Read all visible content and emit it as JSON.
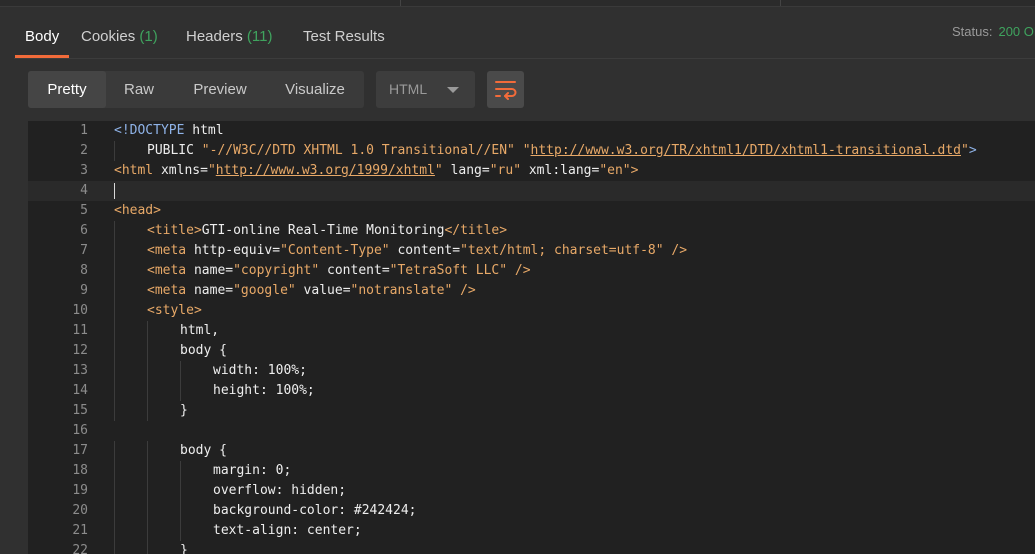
{
  "tabs": [
    {
      "label": "Body",
      "count": null,
      "active": true
    },
    {
      "label": "Cookies",
      "count": "(1)",
      "active": false
    },
    {
      "label": "Headers",
      "count": "(11)",
      "active": false
    },
    {
      "label": "Test Results",
      "count": null,
      "active": false
    }
  ],
  "status": {
    "label": "Status:",
    "value": "200 OK"
  },
  "view_modes": [
    "Pretty",
    "Raw",
    "Preview",
    "Visualize"
  ],
  "active_view": "Pretty",
  "language": {
    "selected": "HTML"
  },
  "wrap_icon": "wrap-lines-icon",
  "colors": {
    "accent": "#f26b3a",
    "count_green": "#3fa35e",
    "tag": "#e8a968",
    "doctype": "#8fb3e8"
  },
  "editor": {
    "current_line": 4,
    "lines": [
      {
        "n": "1",
        "indent": 0,
        "tokens": [
          [
            "decl",
            "<!DOCTYPE"
          ],
          [
            "plain",
            " html"
          ]
        ]
      },
      {
        "n": "2",
        "indent": 1,
        "tokens": [
          [
            "plain",
            "PUBLIC "
          ],
          [
            "str",
            "\"-//W3C//DTD XHTML 1.0 Transitional//EN\""
          ],
          [
            "plain",
            " "
          ],
          [
            "str",
            "\""
          ],
          [
            "url",
            "http://www.w3.org/TR/xhtml1/DTD/xhtml1-transitional.dtd"
          ],
          [
            "str",
            "\""
          ],
          [
            "decl",
            ">"
          ]
        ]
      },
      {
        "n": "3",
        "indent": 0,
        "tokens": [
          [
            "tag",
            "<html"
          ],
          [
            "attr",
            " xmlns="
          ],
          [
            "str",
            "\""
          ],
          [
            "url",
            "http://www.w3.org/1999/xhtml"
          ],
          [
            "str",
            "\""
          ],
          [
            "attr",
            " lang="
          ],
          [
            "str",
            "\"ru\""
          ],
          [
            "attr",
            " xml:lang="
          ],
          [
            "str",
            "\"en\""
          ],
          [
            "tag",
            ">"
          ]
        ]
      },
      {
        "n": "4",
        "indent": 0,
        "tokens": []
      },
      {
        "n": "5",
        "indent": 0,
        "tokens": [
          [
            "tag",
            "<head>"
          ]
        ]
      },
      {
        "n": "6",
        "indent": 1,
        "tokens": [
          [
            "tag",
            "<title>"
          ],
          [
            "plain",
            "GTI-online Real-Time Monitoring"
          ],
          [
            "tag",
            "</title>"
          ]
        ]
      },
      {
        "n": "7",
        "indent": 1,
        "tokens": [
          [
            "tag",
            "<meta"
          ],
          [
            "attr",
            " http-equiv="
          ],
          [
            "str",
            "\"Content-Type\""
          ],
          [
            "attr",
            " content="
          ],
          [
            "str",
            "\"text/html; charset=utf-8\""
          ],
          [
            "tag",
            " />"
          ]
        ]
      },
      {
        "n": "8",
        "indent": 1,
        "tokens": [
          [
            "tag",
            "<meta"
          ],
          [
            "attr",
            " name="
          ],
          [
            "str",
            "\"copyright\""
          ],
          [
            "attr",
            " content="
          ],
          [
            "str",
            "\"TetraSoft LLC\""
          ],
          [
            "tag",
            " />"
          ]
        ]
      },
      {
        "n": "9",
        "indent": 1,
        "tokens": [
          [
            "tag",
            "<meta"
          ],
          [
            "attr",
            " name="
          ],
          [
            "str",
            "\"google\""
          ],
          [
            "attr",
            " value="
          ],
          [
            "str",
            "\"notranslate\""
          ],
          [
            "tag",
            " />"
          ]
        ]
      },
      {
        "n": "10",
        "indent": 1,
        "tokens": [
          [
            "tag",
            "<style>"
          ]
        ]
      },
      {
        "n": "11",
        "indent": 2,
        "tokens": [
          [
            "plain",
            "html,"
          ]
        ]
      },
      {
        "n": "12",
        "indent": 2,
        "tokens": [
          [
            "plain",
            "body {"
          ]
        ]
      },
      {
        "n": "13",
        "indent": 3,
        "tokens": [
          [
            "plain",
            "width: 100%;"
          ]
        ]
      },
      {
        "n": "14",
        "indent": 3,
        "tokens": [
          [
            "plain",
            "height: 100%;"
          ]
        ]
      },
      {
        "n": "15",
        "indent": 2,
        "tokens": [
          [
            "plain",
            "}"
          ]
        ]
      },
      {
        "n": "16",
        "indent": 0,
        "tokens": []
      },
      {
        "n": "17",
        "indent": 2,
        "tokens": [
          [
            "plain",
            "body {"
          ]
        ]
      },
      {
        "n": "18",
        "indent": 3,
        "tokens": [
          [
            "plain",
            "margin: 0;"
          ]
        ]
      },
      {
        "n": "19",
        "indent": 3,
        "tokens": [
          [
            "plain",
            "overflow: hidden;"
          ]
        ]
      },
      {
        "n": "20",
        "indent": 3,
        "tokens": [
          [
            "plain",
            "background-color: #242424;"
          ]
        ]
      },
      {
        "n": "21",
        "indent": 3,
        "tokens": [
          [
            "plain",
            "text-align: center;"
          ]
        ]
      },
      {
        "n": "22",
        "indent": 2,
        "tokens": [
          [
            "plain",
            "}"
          ]
        ]
      }
    ]
  }
}
